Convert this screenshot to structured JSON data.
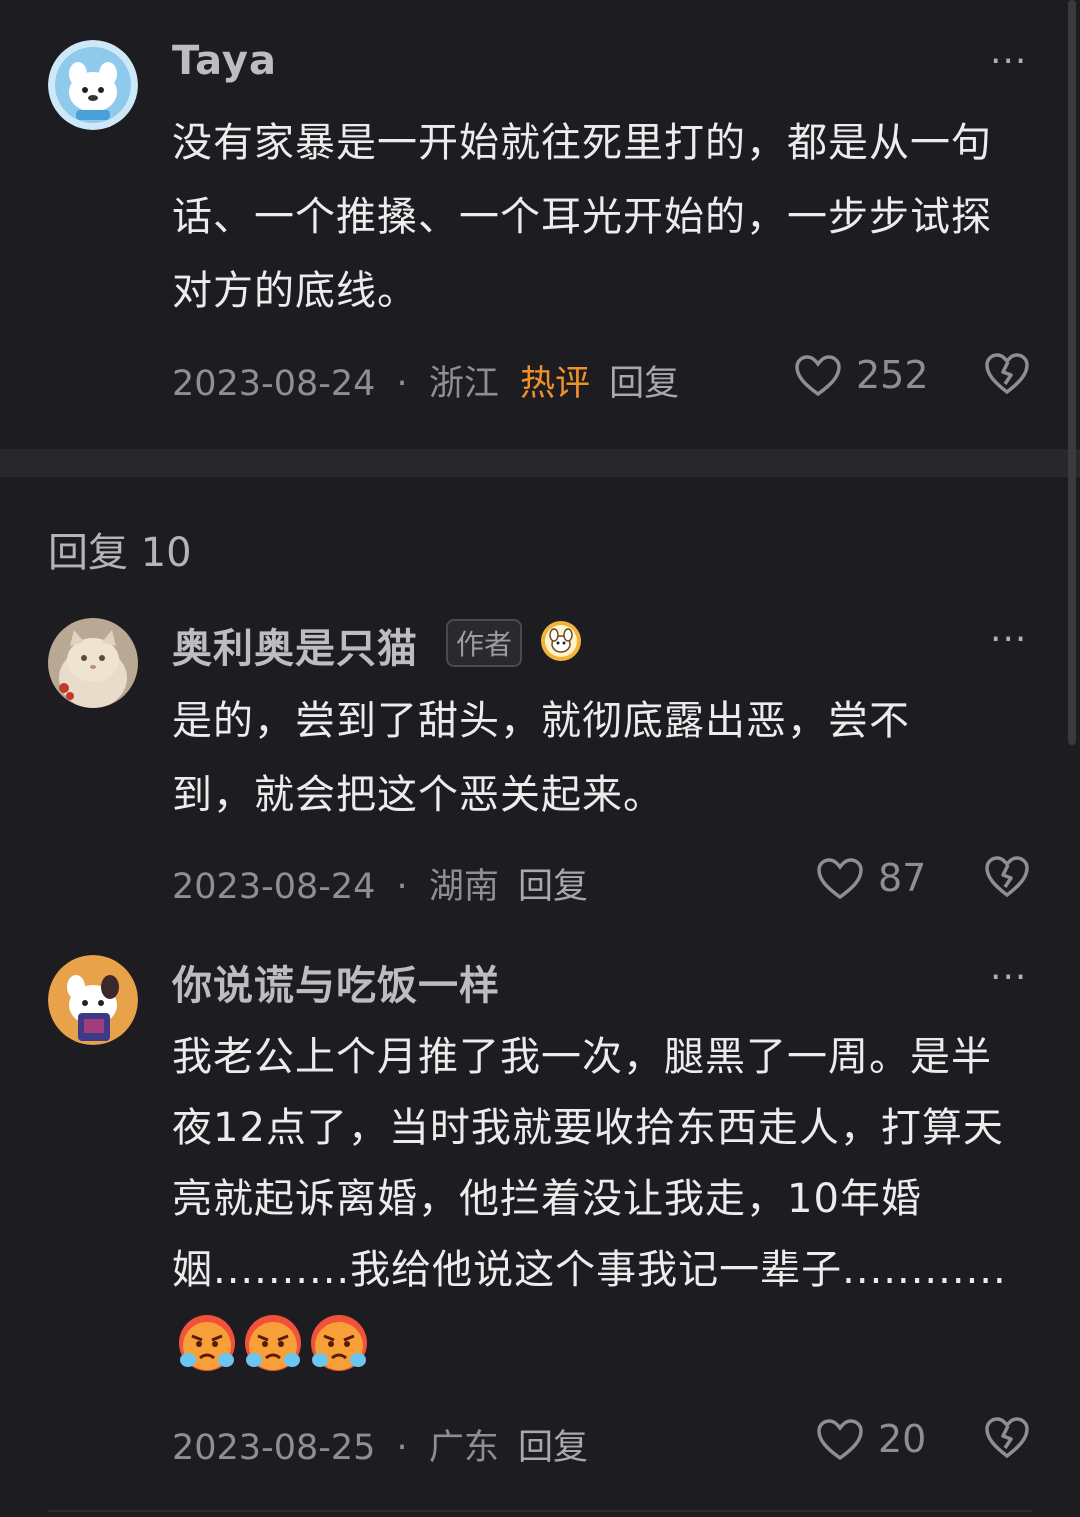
{
  "comments": [
    {
      "username": "Taya",
      "content": "没有家暴是一开始就往死里打的，都是从一句话、一个推搡、一个耳光开始的，一步步试探对方的底线。",
      "date": "2023-08-24",
      "separator": "·",
      "location": "浙江",
      "hot_label": "热评",
      "reply_label": "回复",
      "likes": "252",
      "more": "···"
    }
  ],
  "replies": {
    "header": "回复 10",
    "items": [
      {
        "username": "奥利奥是只猫",
        "badge": "作者",
        "content": "是的，尝到了甜头，就彻底露出恶，尝不到，就会把这个恶关起来。",
        "date": "2023-08-24",
        "separator": "·",
        "location": "湖南",
        "reply_label": "回复",
        "likes": "87",
        "more": "···"
      },
      {
        "username": "你说谎与吃饭一样",
        "content": "我老公上个月推了我一次，腿黑了一周。是半夜12点了，当时我就要收拾东西走人，打算天亮就起诉离婚，他拦着没让我走，10年婚姻..........我给他说这个事我记一辈子............",
        "emojis": [
          "angry-crying-emoji",
          "angry-crying-emoji",
          "angry-crying-emoji"
        ],
        "date": "2023-08-25",
        "separator": "·",
        "location": "广东",
        "reply_label": "回复",
        "likes": "20",
        "more": "···"
      }
    ]
  },
  "colors": {
    "background": "#161619",
    "card": "#1d1d21",
    "hot": "#f0902a",
    "text": "#ececec",
    "meta": "#8e8e93"
  }
}
